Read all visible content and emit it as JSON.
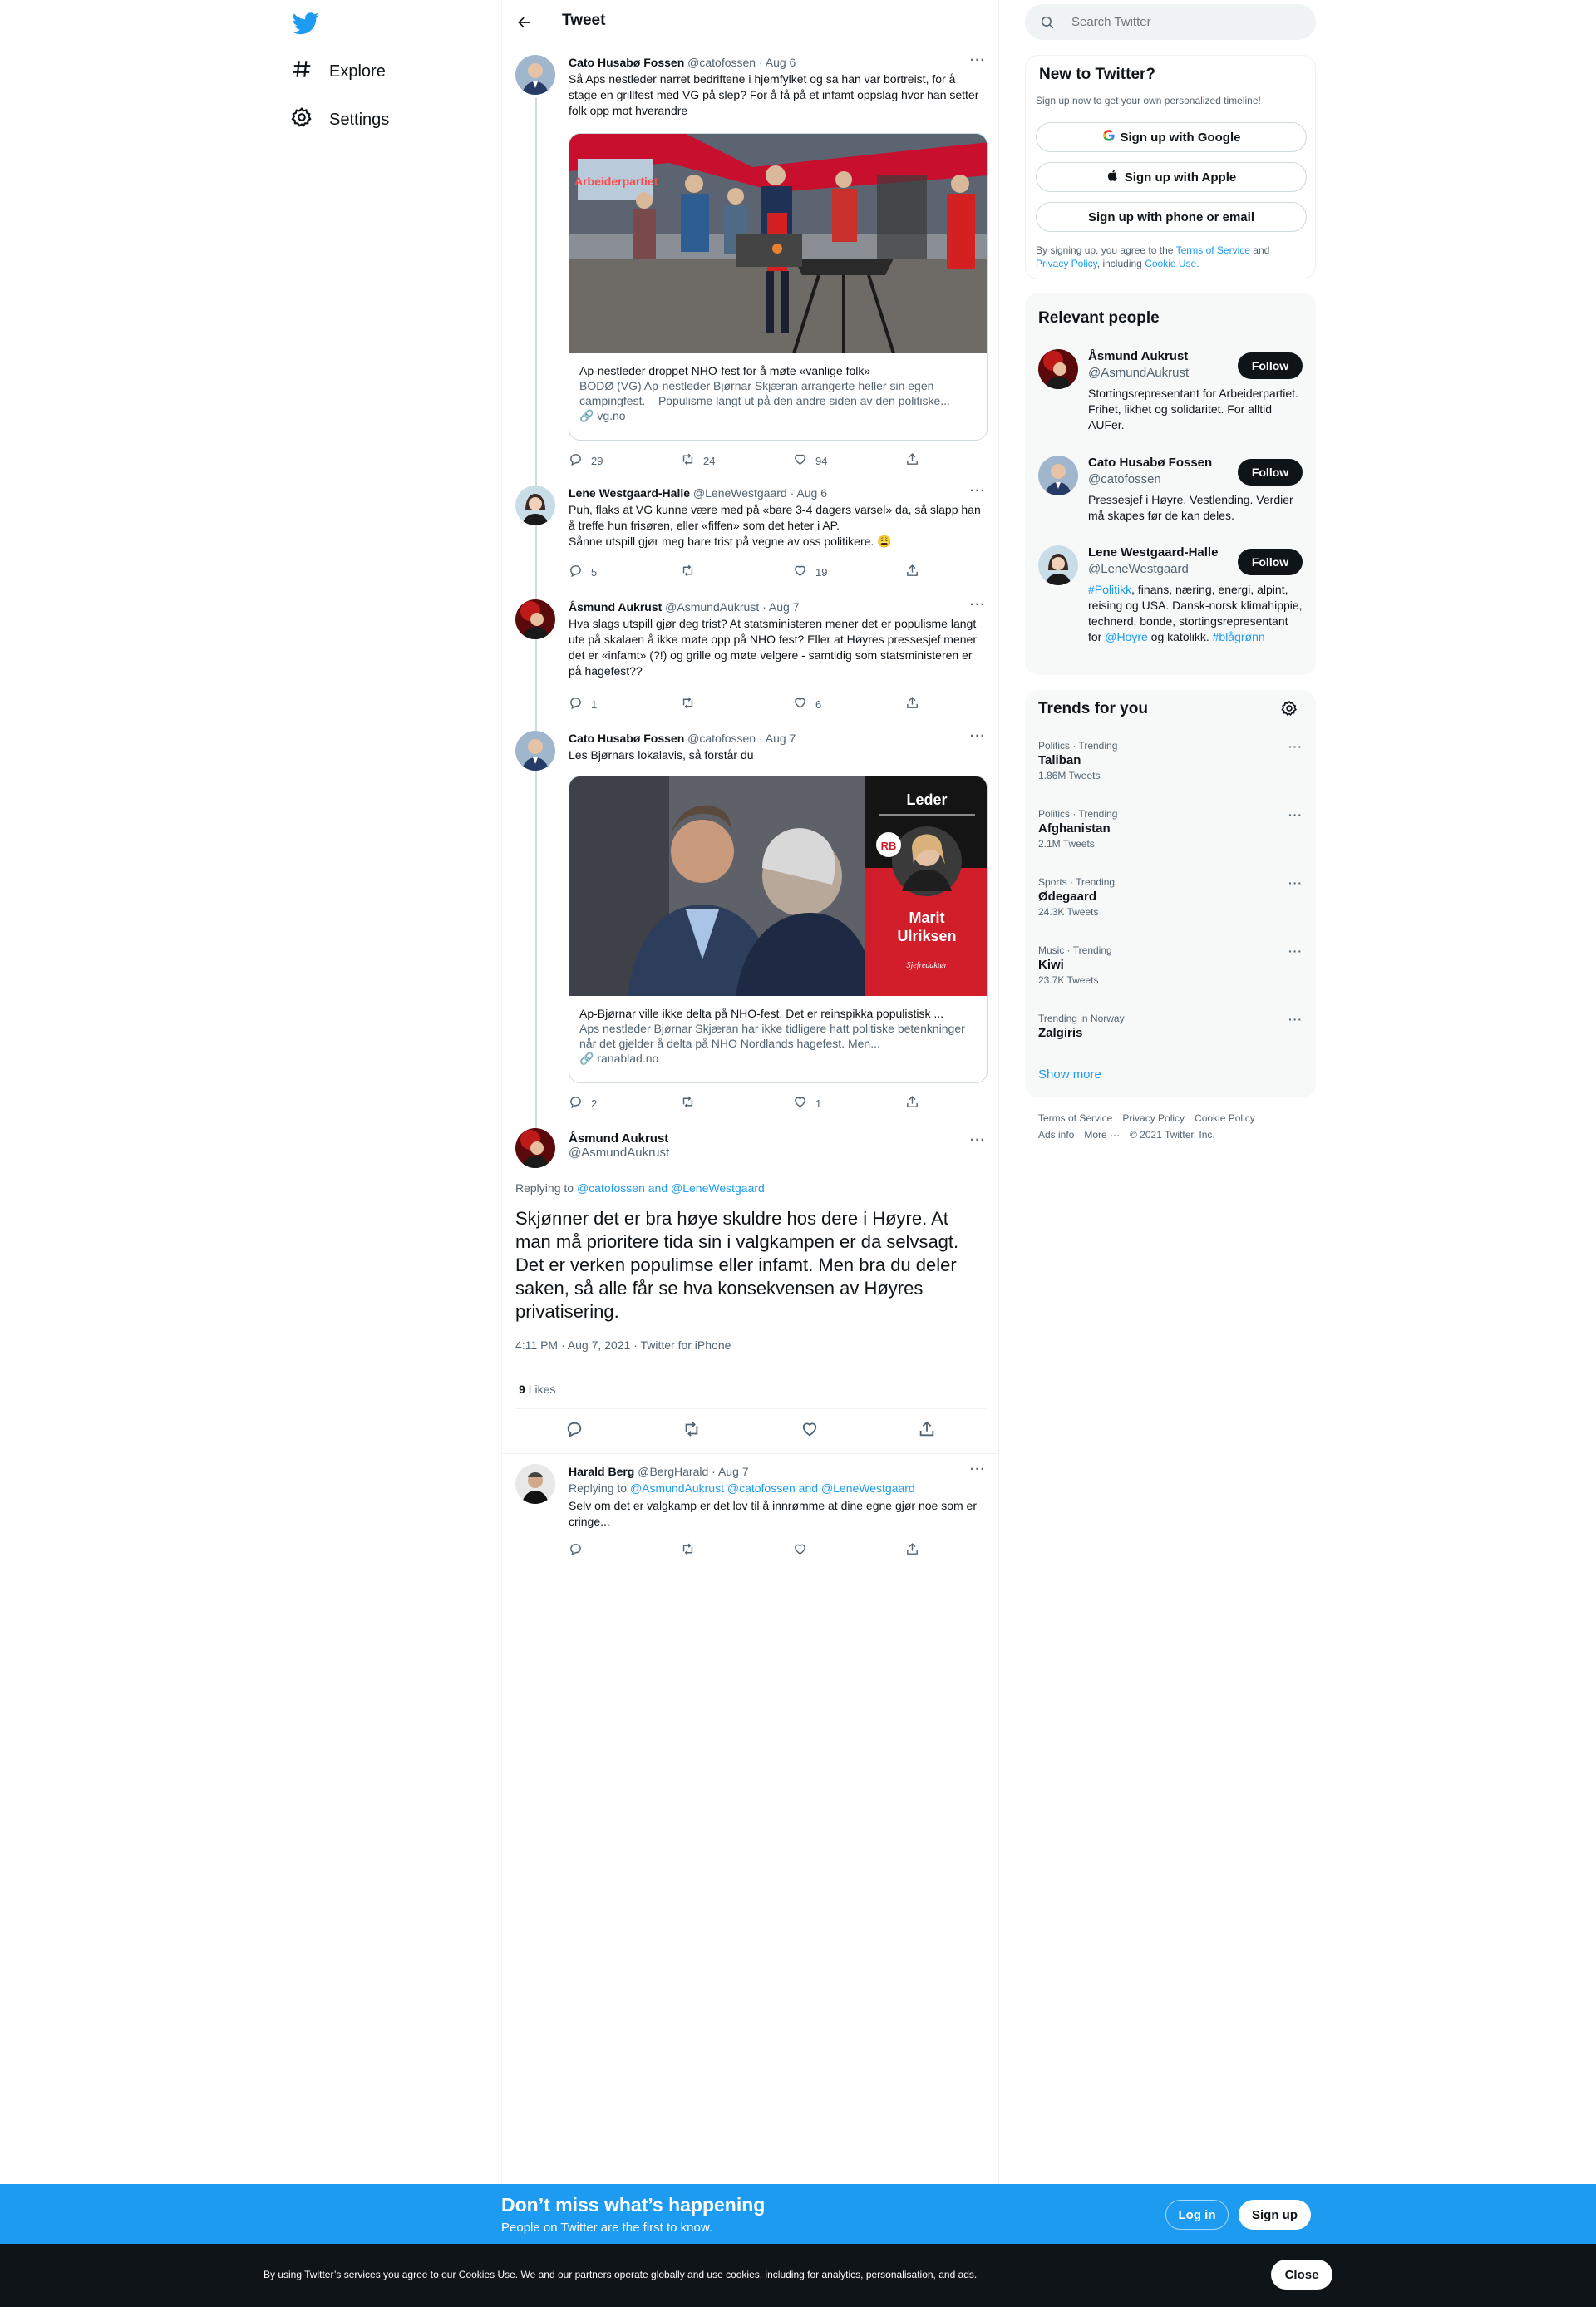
{
  "colors": {
    "accent": "#1d9bf0",
    "text": "#0f1419",
    "muted": "#536471",
    "border": "#cfd9de"
  },
  "nav": {
    "logo_icon": "twitter-bird-icon",
    "items": [
      {
        "label": "Explore",
        "icon": "hashtag-icon"
      },
      {
        "label": "Settings",
        "icon": "gear-icon"
      }
    ]
  },
  "header": {
    "title": "Tweet"
  },
  "tweets": [
    {
      "name": "Cato Husabø Fossen",
      "handle": "@catofossen",
      "date": "· Aug 6",
      "text": "Så Aps nestleder narret bedriftene i hjemfylket og sa han var bortreist, for å stage en grillfest med VG på slep? For å få på et infamt oppslag hvor han setter folk opp mot hverandre",
      "card": {
        "title": "Ap-nestleder droppet NHO-fest for å møte «vanlige folk»",
        "description": "BODØ (VG) Ap-nestleder Bjørnar Skjæran arrangerte heller sin egen campingfest. – Populisme langt ut på den andre siden av den politiske...",
        "domain": "vg.no",
        "image_banner": "Arbeiderpartiet"
      },
      "replies": "29",
      "retweets": "24",
      "likes": "94"
    },
    {
      "name": "Lene Westgaard-Halle",
      "handle": "@LeneWestgaard",
      "date": "· Aug 6",
      "text": "Puh, flaks at VG kunne være med på «bare 3-4 dagers varsel» da, så slapp han å treffe hun frisøren, eller «fiffen» som det heter i AP.\nSånne utspill gjør meg bare trist på vegne av oss politikere. 😩",
      "replies": "5",
      "retweets": "",
      "likes": "19"
    },
    {
      "name": "Åsmund Aukrust",
      "handle": "@AsmundAukrust",
      "date": "· Aug 7",
      "text": "Hva slags utspill gjør deg trist? At statsministeren mener det er populisme langt ute på skalaen å ikke møte opp på NHO fest? Eller at Høyres pressesjef mener det er «infamt» (?!) og grille og møte velgere - samtidig som statsministeren er på hagefest??",
      "replies": "1",
      "retweets": "",
      "likes": "6"
    },
    {
      "name": "Cato Husabø Fossen",
      "handle": "@catofossen",
      "date": "· Aug 7",
      "text": "Les Bjørnars lokalavis, så forstår du",
      "card": {
        "title": "Ap-Bjørnar ville ikke delta på NHO-fest. Det er reinspikka populistisk ...",
        "description": "Aps nestleder Bjørnar Skjæran har ikke tidligere hatt politiske betenkninger når det gjelder å delta på NHO Nordlands hagefest. Men...",
        "domain": "ranablad.no",
        "leader_label": "Leder",
        "logo": "RB",
        "person_name": "Marit Ulriksen",
        "person_role": "Sjefredaktør"
      },
      "replies": "2",
      "retweets": "",
      "likes": "1"
    }
  ],
  "focus": {
    "name": "Åsmund Aukrust",
    "handle": "@AsmundAukrust",
    "replying_prefix": "Replying to",
    "replying_to": "@catofossen and @LeneWestgaard",
    "text": "Skjønner det er bra høye skuldre hos dere i Høyre. At man må prioritere tida sin i valgkampen er da selvsagt. Det er verken populimse eller infamt. Men bra du deler saken, så alle får se hva konsekvensen av Høyres privatisering.",
    "time": "4:11 PM · Aug 7, 2021 · Twitter for iPhone",
    "likes_count": "9",
    "likes_label": "Likes"
  },
  "reply": {
    "name": "Harald Berg",
    "handle": "@BergHarald",
    "date": "· Aug 7",
    "replying_prefix": "Replying to",
    "replying_to": "@AsmundAukrust @catofossen and @LeneWestgaard",
    "text": "Selv om det er valgkamp er det lov til å innrømme at dine egne gjør noe som er cringe..."
  },
  "search": {
    "placeholder": "Search Twitter"
  },
  "new_to_twitter": {
    "title": "New to Twitter?",
    "subtitle": "Sign up now to get your own personalized timeline!",
    "google": "Sign up with Google",
    "apple": "Sign up with Apple",
    "phone": "Sign up with phone or email",
    "terms_prefix": "By signing up, you agree to the",
    "terms": "Terms of Service",
    "and": "and",
    "privacy": "Privacy Policy",
    "including": ", including",
    "cookie": "Cookie Use."
  },
  "relevant_people": {
    "title": "Relevant people",
    "follow_label": "Follow",
    "people": [
      {
        "name": "Åsmund Aukrust",
        "handle": "@AsmundAukrust",
        "bio": "Stortingsrepresentant for Arbeiderpartiet. Frihet, likhet og solidaritet. For alltid AUFer."
      },
      {
        "name": "Cato Husabø Fossen",
        "handle": "@catofossen",
        "bio": "Pressesjef i Høyre. Vestlending. Verdier må skapes før de kan deles."
      },
      {
        "name": "Lene Westgaard-Halle",
        "handle": "@LeneWestgaard",
        "bio_link1": "#Politikk",
        "bio_mid": ", finans, næring, energi, alpint, reising og USA. Dansk-norsk klimahippie, technerd, bonde, stortingsrepresentant for ",
        "bio_link2": "@Hoyre",
        "bio_mid2": " og katolikk. ",
        "bio_link3": "#blågrønn"
      }
    ]
  },
  "trends": {
    "title": "Trends for you",
    "items": [
      {
        "context": "Politics · Trending",
        "name": "Taliban",
        "count": "1.86M Tweets"
      },
      {
        "context": "Politics · Trending",
        "name": "Afghanistan",
        "count": "2.1M Tweets"
      },
      {
        "context": "Sports · Trending",
        "name": "Ødegaard",
        "count": "24.3K Tweets"
      },
      {
        "context": "Music · Trending",
        "name": "Kiwi",
        "count": "23.7K Tweets"
      },
      {
        "context": "Trending in Norway",
        "name": "Zalgiris",
        "count": ""
      }
    ],
    "show_more": "Show more"
  },
  "footer": {
    "terms": "Terms of Service",
    "privacy": "Privacy Policy",
    "cookie": "Cookie Policy",
    "ads": "Ads info",
    "more": "More ···",
    "copyright": "© 2021 Twitter, Inc."
  },
  "promo": {
    "title": "Don’t miss what’s happening",
    "subtitle": "People on Twitter are the first to know.",
    "login": "Log in",
    "signup": "Sign up"
  },
  "cookie_bar": {
    "text": "By using Twitter’s services you agree to our Cookies Use. We and our partners operate globally and use cookies, including for analytics, personalisation, and ads.",
    "close": "Close"
  }
}
